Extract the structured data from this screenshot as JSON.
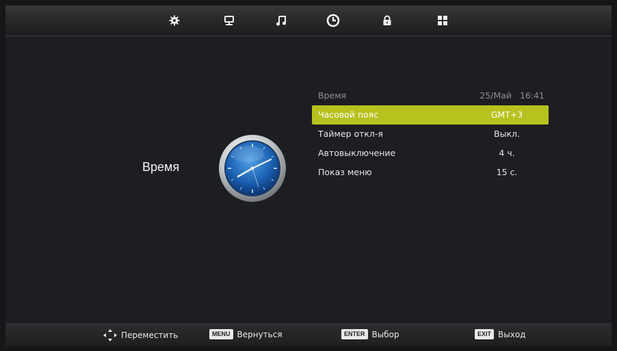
{
  "colors": {
    "accent": "#b6c21d",
    "background": "#1d1e21",
    "muted_text": "#8d8f93"
  },
  "tabs": [
    {
      "icon": "gear-icon"
    },
    {
      "icon": "monitor-icon"
    },
    {
      "icon": "music-note-icon"
    },
    {
      "icon": "clock-icon",
      "active": true
    },
    {
      "icon": "lock-icon"
    },
    {
      "icon": "apps-grid-icon"
    }
  ],
  "section": {
    "title": "Время",
    "icon": "clock-icon"
  },
  "settings": {
    "header": {
      "label": "Время",
      "value": "25/Май   16:41"
    },
    "rows": [
      {
        "label": "Часовой пояс",
        "value": "GMT+3",
        "selected": true
      },
      {
        "label": "Таймер откл-я",
        "value": "Выкл."
      },
      {
        "label": "Автовыключение",
        "value": "4 ч."
      },
      {
        "label": "Показ меню",
        "value": "15 с."
      }
    ]
  },
  "hints": {
    "move": {
      "icon": "dpad-arrows-icon",
      "text": "Переместить"
    },
    "back": {
      "key": "MENU",
      "text": "Вернуться"
    },
    "select": {
      "key": "ENTER",
      "text": "Выбор"
    },
    "exit": {
      "key": "EXIT",
      "text": "Выход"
    }
  }
}
